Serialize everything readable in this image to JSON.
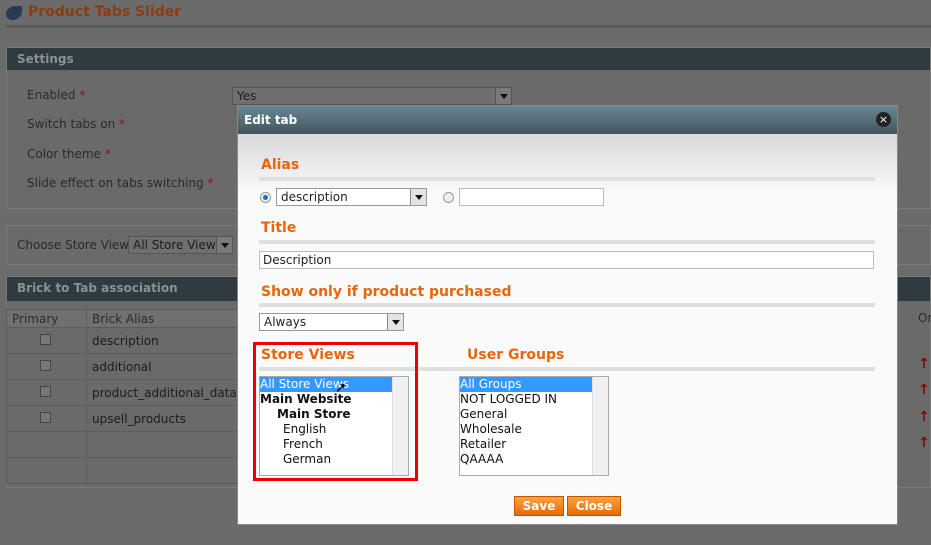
{
  "page": {
    "title": "Product Tabs Slider"
  },
  "settings": {
    "header": "Settings",
    "fields": [
      {
        "label": "Enabled",
        "value": "Yes"
      },
      {
        "label": "Switch tabs on"
      },
      {
        "label": "Color theme"
      },
      {
        "label": "Slide effect on tabs switching"
      }
    ],
    "required_mark": "*"
  },
  "store_view": {
    "label": "Choose Store View:",
    "value": "All Store Views"
  },
  "brick": {
    "header": "Brick to Tab association",
    "columns": [
      "Primary",
      "Brick Alias",
      "Or"
    ],
    "rows": [
      "description",
      "additional",
      "product_additional_data",
      "upsell_products",
      "",
      ""
    ]
  },
  "modal": {
    "title": "Edit tab",
    "close_icon": "×",
    "alias": {
      "label": "Alias",
      "select_value": "description",
      "custom_value": ""
    },
    "title_field": {
      "label": "Title",
      "value": "Description"
    },
    "purchased": {
      "label": "Show only if product purchased",
      "value": "Always"
    },
    "store_views": {
      "label": "Store Views",
      "options": [
        "All Store Views",
        "Main Website",
        "Main Store",
        "English",
        "French",
        "German"
      ],
      "selected": "All Store Views"
    },
    "user_groups": {
      "label": "User Groups",
      "options": [
        "All Groups",
        "NOT LOGGED IN",
        "General",
        "Wholesale",
        "Retailer",
        "QAAAA"
      ],
      "selected": "All Groups"
    },
    "save_label": "Save",
    "close_label": "Close"
  },
  "colors": {
    "accent": "#e8650a",
    "highlight_box": "#ee0000",
    "selection": "#3399ff"
  }
}
